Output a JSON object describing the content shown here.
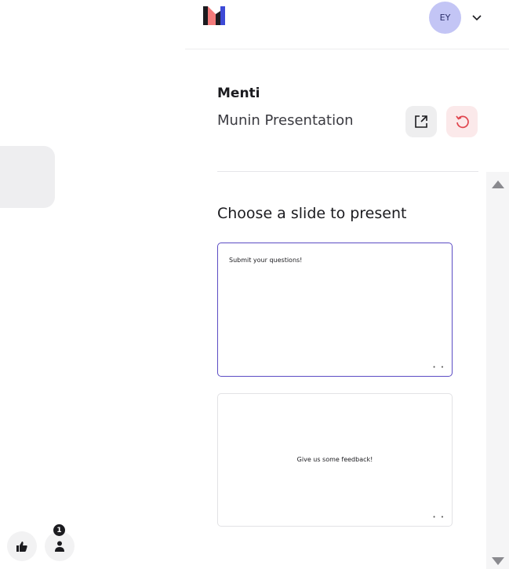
{
  "header": {
    "avatar_initials": "EY",
    "logo_icon": "menti-logo",
    "chevron_icon": "chevron-down-icon"
  },
  "panel": {
    "title": "Menti",
    "subtitle": "Munin Presentation",
    "open_icon": "external-link-icon",
    "reset_icon": "reset-icon"
  },
  "slides": {
    "heading": "Choose a slide to present",
    "items": [
      {
        "text": "Submit your questions!",
        "dots": "• •",
        "selected": true
      },
      {
        "text": "Give us some feedback!",
        "dots": "• •",
        "selected": false
      }
    ]
  },
  "reactions": {
    "like_icon": "thumbs-up-icon",
    "people_icon": "person-icon",
    "people_count": "1"
  },
  "colors": {
    "accent": "#5b4cc4",
    "avatar_bg": "#c3c5f5",
    "reset_bg": "#fbe9ea",
    "reset_icon": "#e0454e"
  }
}
